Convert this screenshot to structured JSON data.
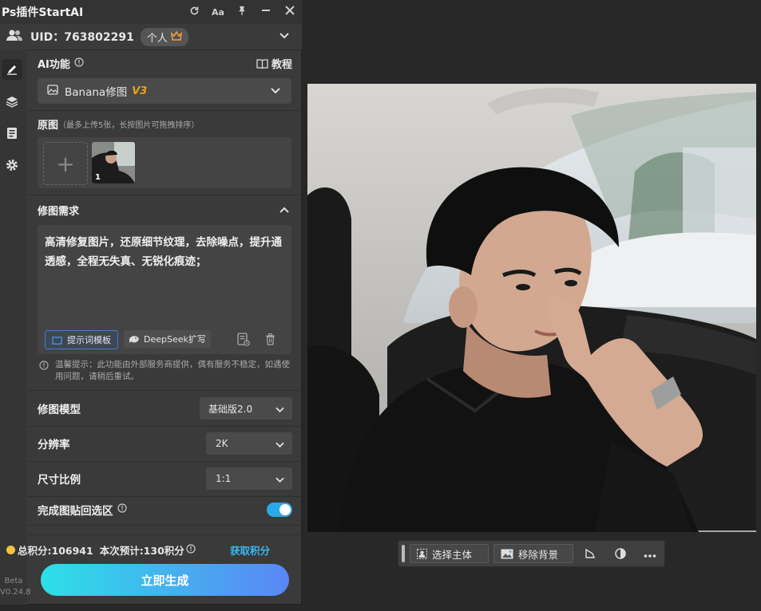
{
  "app": {
    "title": "Ps插件StartAI",
    "title_icons": [
      "refresh-icon",
      "font-size-icon",
      "pin-icon",
      "minimize-icon",
      "close-icon"
    ],
    "font_label": "Aa"
  },
  "user": {
    "uid_label": "UID：763802291",
    "plan": "个人"
  },
  "ai_function": {
    "label": "AI功能",
    "tutorial": "教程",
    "selected": "Banana修图",
    "version": "V3"
  },
  "source_images": {
    "label": "原图",
    "hint": "（最多上传5张，长按图片可拖拽排序）",
    "add_symbol": "+",
    "thumb_index": "1"
  },
  "edit_request": {
    "label": "修图需求",
    "text": "高清修复图片，还原细节纹理，去除噪点，提升通透感，全程无失真、无锐化痕迹；",
    "template_btn": "提示词模板",
    "deepseek_btn": "DeepSeek扩写"
  },
  "tip": "温馨提示：此功能由外部服务商提供，偶有服务不稳定，如遇使用问题，请稍后重试。",
  "params": {
    "model_label": "修图模型",
    "model_value": "基础版2.0",
    "resolution_label": "分辨率",
    "resolution_value": "2K",
    "ratio_label": "尺寸比例",
    "ratio_value": "1:1",
    "paste_back_label": "完成图贴回选区",
    "paste_back_on": true
  },
  "footer": {
    "total_points": "总积分:106941",
    "estimate": "本次预计:130积分",
    "get_points": "获取积分",
    "generate": "立即生成"
  },
  "sidebar": {
    "beta": "Beta",
    "version": "V0.24.8",
    "items": [
      "edit-icon",
      "layers-icon",
      "notes-icon",
      "settings-icon"
    ]
  },
  "photo_toolbar": {
    "select_subject": "选择主体",
    "remove_bg": "移除背景"
  },
  "colors": {
    "accent_blue": "#39b8f0",
    "gradient_start": "#2ce0e8",
    "gradient_end": "#5a86f5",
    "v3_gold": "#e8a317",
    "toggle_on": "#2aa9e8"
  }
}
